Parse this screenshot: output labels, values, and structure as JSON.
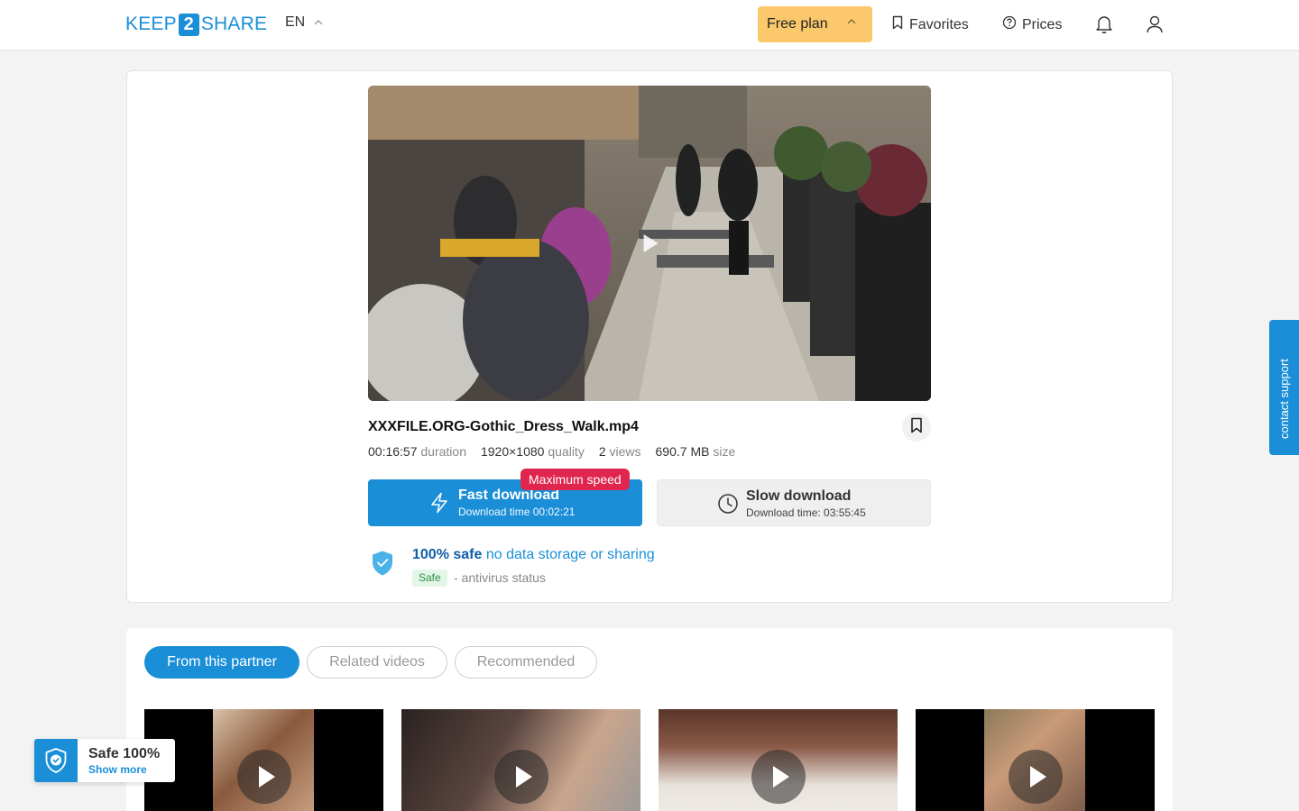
{
  "header": {
    "logo": {
      "left": "KEEP",
      "num": "2",
      "right": "SHARE"
    },
    "lang": "EN",
    "plan": "Free plan",
    "favorites": "Favorites",
    "prices": "Prices",
    "icons": [
      "bookmark-icon",
      "question-icon",
      "bell-icon",
      "user-icon",
      "chevron-up-icon"
    ]
  },
  "file": {
    "name": "XXXFILE.ORG-Gothic_Dress_Walk.mp4",
    "duration_value": "00:16:57",
    "duration_label": "duration",
    "quality_value": "1920×1080",
    "quality_label": "quality",
    "views_value": "2",
    "views_label": "views",
    "size_value": "690.7 MB",
    "size_label": "size"
  },
  "downloads": {
    "fast_title": "Fast download",
    "fast_sub": "Download time 00:02:21",
    "max_speed_badge": "Maximum speed",
    "slow_title": "Slow download",
    "slow_sub": "Download time: 03:55:45"
  },
  "safety": {
    "safe_bold": "100% safe",
    "safe_rest": " no data storage or sharing",
    "tag": "Safe",
    "status": "- antivirus status"
  },
  "tabs": [
    {
      "label": "From this partner",
      "active": true
    },
    {
      "label": "Related videos",
      "active": false
    },
    {
      "label": "Recommended",
      "active": false
    }
  ],
  "contact": "contact support",
  "safe_widget": {
    "title": "Safe 100%",
    "link": "Show more"
  },
  "colors": {
    "accent": "#1a8fd8",
    "plan": "#fbc96b",
    "badge": "#e0254f"
  }
}
